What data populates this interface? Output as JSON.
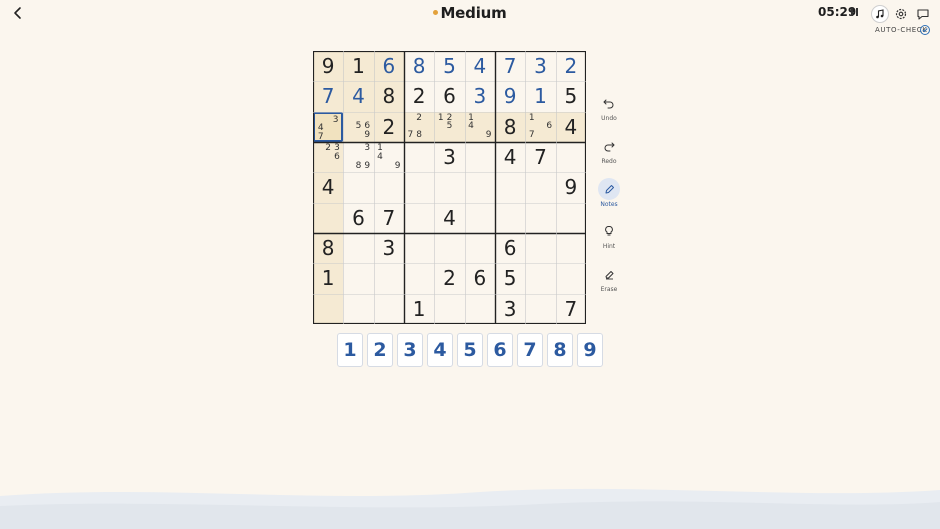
{
  "header": {
    "difficulty": "Medium",
    "timer": "05:29",
    "autocheck_label": "AUTO-CHECK"
  },
  "icons": {
    "back": "chevron-left-icon",
    "pause": "pause-icon",
    "music": "music-note-icon",
    "settings": "gear-icon",
    "chat": "chat-bubble-icon",
    "autocheck": "check-circle-icon"
  },
  "tools": [
    {
      "label": "Undo",
      "icon": "undo-icon"
    },
    {
      "label": "Redo",
      "icon": "redo-icon"
    },
    {
      "label": "Notes",
      "icon": "pencil-icon",
      "active": true
    },
    {
      "label": "Hint",
      "icon": "lightbulb-icon"
    },
    {
      "label": "Erase",
      "icon": "eraser-icon"
    }
  ],
  "numpad": [
    "1",
    "2",
    "3",
    "4",
    "5",
    "6",
    "7",
    "8",
    "9"
  ],
  "colors": {
    "background": "#fbf6ee",
    "highlight": "#f5ead3",
    "selected": "#f1e2bf",
    "selected_border": "#2c5aa0",
    "user_digit": "#2c5aa0",
    "given_digit": "#222222",
    "accent_dot": "#e3a13a"
  },
  "board": {
    "selected": [
      2,
      0
    ],
    "cells": [
      [
        {
          "v": "9",
          "g": true
        },
        {
          "v": "1",
          "g": true
        },
        {
          "v": "6",
          "g": false
        },
        {
          "v": "8",
          "g": false
        },
        {
          "v": "5",
          "g": false
        },
        {
          "v": "4",
          "g": false
        },
        {
          "v": "7",
          "g": false
        },
        {
          "v": "3",
          "g": false
        },
        {
          "v": "2",
          "g": false
        }
      ],
      [
        {
          "v": "7",
          "g": false
        },
        {
          "v": "4",
          "g": false
        },
        {
          "v": "8",
          "g": true
        },
        {
          "v": "2",
          "g": true
        },
        {
          "v": "6",
          "g": true
        },
        {
          "v": "3",
          "g": false
        },
        {
          "v": "9",
          "g": false
        },
        {
          "v": "1",
          "g": false
        },
        {
          "v": "5",
          "g": true
        }
      ],
      [
        {
          "n": [
            "3",
            "4",
            "7"
          ]
        },
        {
          "n": [
            "5",
            "6",
            "9"
          ]
        },
        {
          "v": "2",
          "g": true
        },
        {
          "n": [
            "2",
            "7",
            "8"
          ]
        },
        {
          "n": [
            "1",
            "2",
            "5"
          ]
        },
        {
          "n": [
            "1",
            "4",
            "9"
          ]
        },
        {
          "v": "8",
          "g": true
        },
        {
          "n": [
            "1",
            "6",
            "7"
          ]
        },
        {
          "v": "4",
          "g": true
        }
      ],
      [
        {
          "n": [
            "2",
            "3",
            "6"
          ]
        },
        {
          "n": [
            "3",
            "8",
            "9"
          ]
        },
        {
          "n": [
            "1",
            "4",
            "9"
          ]
        },
        {
          "v": "",
          "g": true
        },
        {
          "v": "3",
          "g": true
        },
        {
          "v": "",
          "g": true
        },
        {
          "v": "4",
          "g": true
        },
        {
          "v": "7",
          "g": true
        },
        {
          "v": "",
          "g": true
        }
      ],
      [
        {
          "v": "4",
          "g": true
        },
        {
          "v": "",
          "g": true
        },
        {
          "v": "",
          "g": true
        },
        {
          "v": "",
          "g": true
        },
        {
          "v": "",
          "g": true
        },
        {
          "v": "",
          "g": true
        },
        {
          "v": "",
          "g": true
        },
        {
          "v": "",
          "g": true
        },
        {
          "v": "9",
          "g": true
        }
      ],
      [
        {
          "v": "",
          "g": true
        },
        {
          "v": "6",
          "g": true
        },
        {
          "v": "7",
          "g": true
        },
        {
          "v": "",
          "g": true
        },
        {
          "v": "4",
          "g": true
        },
        {
          "v": "",
          "g": true
        },
        {
          "v": "",
          "g": true
        },
        {
          "v": "",
          "g": true
        },
        {
          "v": "",
          "g": true
        }
      ],
      [
        {
          "v": "8",
          "g": true
        },
        {
          "v": "",
          "g": true
        },
        {
          "v": "3",
          "g": true
        },
        {
          "v": "",
          "g": true
        },
        {
          "v": "",
          "g": true
        },
        {
          "v": "",
          "g": true
        },
        {
          "v": "6",
          "g": true
        },
        {
          "v": "",
          "g": true
        },
        {
          "v": "",
          "g": true
        }
      ],
      [
        {
          "v": "1",
          "g": true
        },
        {
          "v": "",
          "g": true
        },
        {
          "v": "",
          "g": true
        },
        {
          "v": "",
          "g": true
        },
        {
          "v": "2",
          "g": true
        },
        {
          "v": "6",
          "g": true
        },
        {
          "v": "5",
          "g": true
        },
        {
          "v": "",
          "g": true
        },
        {
          "v": "",
          "g": true
        }
      ],
      [
        {
          "v": "",
          "g": true
        },
        {
          "v": "",
          "g": true
        },
        {
          "v": "",
          "g": true
        },
        {
          "v": "1",
          "g": true
        },
        {
          "v": "",
          "g": true
        },
        {
          "v": "",
          "g": true
        },
        {
          "v": "3",
          "g": true
        },
        {
          "v": "",
          "g": true
        },
        {
          "v": "7",
          "g": true
        }
      ]
    ]
  }
}
